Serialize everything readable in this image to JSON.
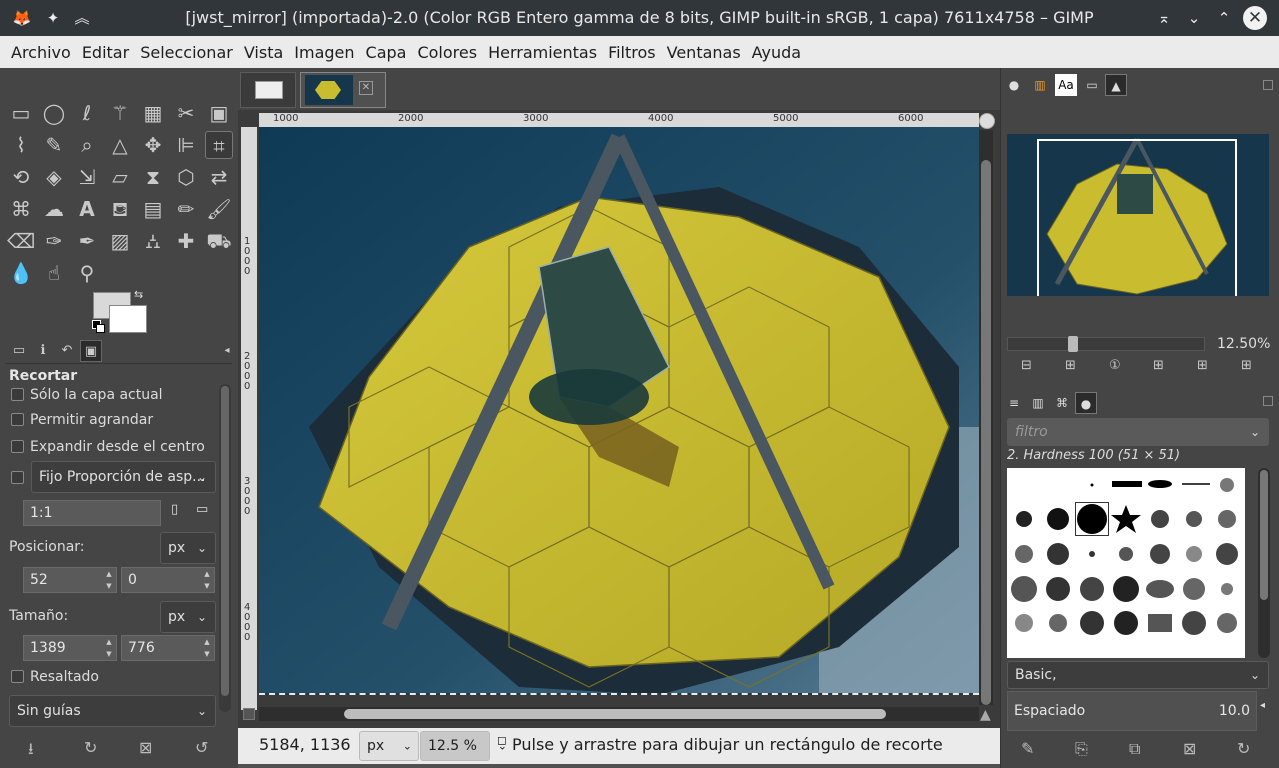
{
  "window": {
    "title": "[jwst_mirror] (importada)-2.0 (Color RGB Entero gamma de 8 bits, GIMP built-in sRGB, 1 capa) 7611x4758 – GIMP",
    "icons": [
      "gimp-logo-icon",
      "pin-icon",
      "keep-above-icon",
      "minimize-icon",
      "restore-icon",
      "maximize-icon",
      "close-icon"
    ]
  },
  "menu": [
    "Archivo",
    "Editar",
    "Seleccionar",
    "Vista",
    "Imagen",
    "Capa",
    "Colores",
    "Herramientas",
    "Filtros",
    "Ventanas",
    "Ayuda"
  ],
  "tool_options": {
    "title": "Recortar",
    "current_layer_only": "Sólo la capa actual",
    "allow_growing": "Permitir agrandar",
    "expand_from_center": "Expandir desde el centro",
    "fixed_combo": "Fijo Proporción de asp...",
    "ratio_value": "1:1",
    "position_label": "Posicionar:",
    "position_unit": "px",
    "position_x": "52",
    "position_y": "0",
    "size_label": "Tamaño:",
    "size_unit": "px",
    "size_w": "1389",
    "size_h": "776",
    "highlight": "Resaltado",
    "guides_combo": "Sin guías"
  },
  "image_window": {
    "rulers_top": [
      "1000",
      "2000",
      "3000",
      "4000",
      "5000",
      "6000"
    ],
    "rulers_left": [
      "1\n0\n0\n0",
      "2\n0\n0\n0",
      "3\n0\n0\n0",
      "4\n0\n0\n0"
    ],
    "status": {
      "coords": "5184, 1136",
      "unit": "px",
      "zoom": "12.5 %",
      "message": "Pulse y arrastre para dibujar un rectángulo de recorte"
    }
  },
  "navigation": {
    "zoom_value": "12.50%"
  },
  "brushes": {
    "filter_placeholder": "filtro",
    "selected_brush": "2. Hardness 100 (51 × 51)",
    "preset": "Basic,",
    "spacing_label": "Espaciado",
    "spacing_value": "10.0"
  },
  "colors": {
    "fg": "#d9d9d9",
    "bg": "#ffffff",
    "mirror_gold": "#c9bd2f"
  }
}
